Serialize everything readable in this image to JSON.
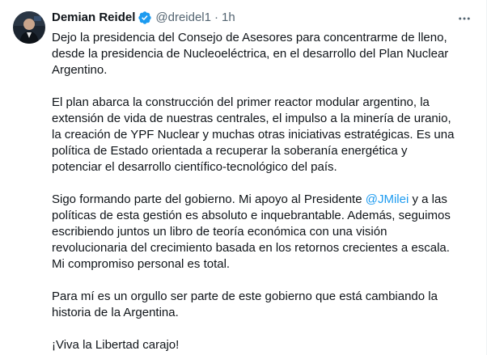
{
  "author": {
    "display_name": "Demian Reidel",
    "handle": "@dreidel1",
    "separator": "·",
    "time": "1h",
    "verified_icon": "verified-badge-icon",
    "verified_color": "#1d9bf0"
  },
  "menu_icon": "more-horizontal-icon",
  "tweet": {
    "p1": {
      "l1": "Dejo la presidencia del Consejo de Asesores para concentrarme de lleno,",
      "l2": "desde la presidencia de Nucleoeléctrica, en el desarrollo del Plan Nuclear",
      "l3": "Argentino."
    },
    "p2": {
      "l1": "El plan abarca la construcción del primer reactor modular argentino, la",
      "l2": "extensión de vida de nuestras centrales, el impulso a la minería de uranio,",
      "l3": "la creación de YPF Nuclear y muchas otras iniciativas estratégicas. Es una",
      "l4": "política de Estado orientada a recuperar la soberanía energética y",
      "l5": "potenciar el desarrollo científico-tecnológico del país."
    },
    "p3": {
      "l1_before": "Sigo formando parte del gobierno. Mi apoyo al Presidente ",
      "mention": "@JMilei",
      "l1_after": " y a las",
      "l2": "políticas de esta gestión es absoluto e inquebrantable. Además, seguimos",
      "l3": "escribiendo juntos un libro de teoría económica con una visión",
      "l4": "revolucionaria del crecimiento basada en los retornos crecientes a escala.",
      "l5": "Mi compromiso personal es total."
    },
    "p4": {
      "l1": "Para mí es un orgullo ser parte de este gobierno que está cambiando la",
      "l2": "historia de la Argentina."
    },
    "p5": {
      "l1": "¡Viva la Libertad carajo!"
    }
  },
  "colors": {
    "text": "#0f1419",
    "secondary": "#536471",
    "link": "#1d9bf0"
  }
}
